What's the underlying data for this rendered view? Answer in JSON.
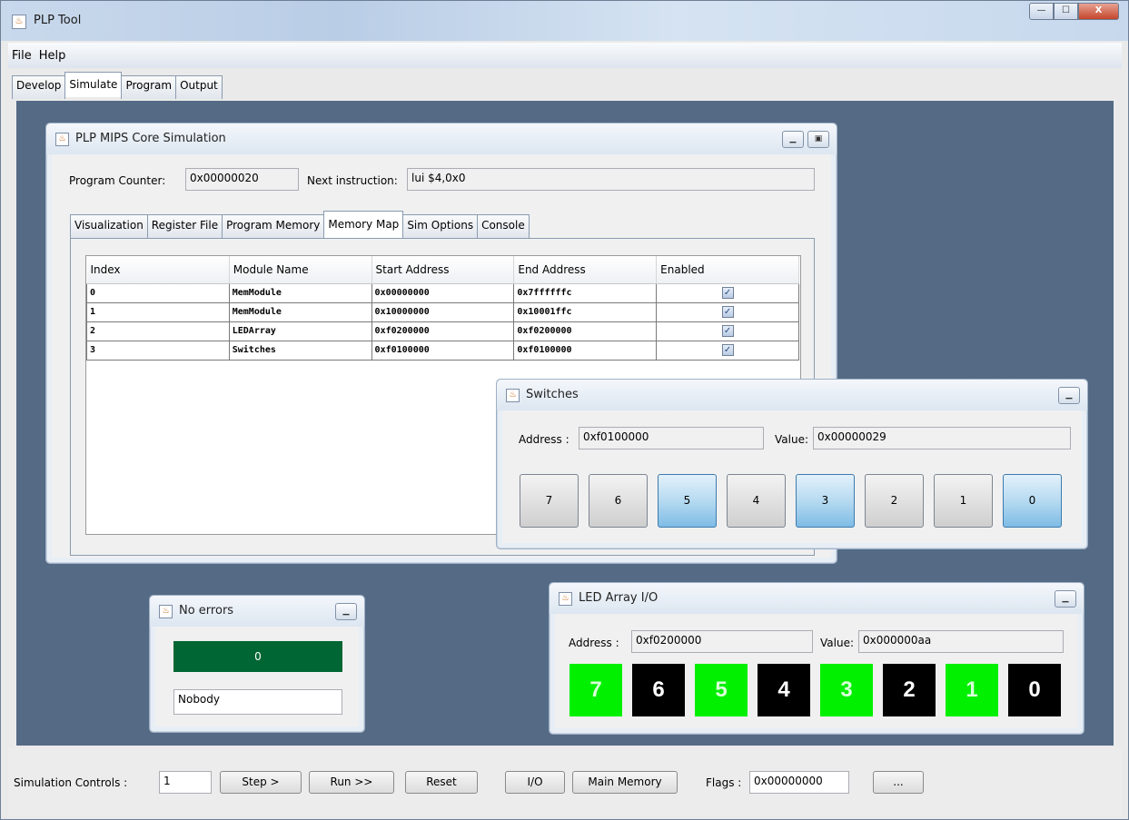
{
  "app": {
    "title": "PLP Tool"
  },
  "window_controls": {
    "minimize": "—",
    "maximize": "☐",
    "close": "X"
  },
  "menu": [
    "File",
    "Help"
  ],
  "main_tabs": [
    {
      "label": "Develop",
      "active": false
    },
    {
      "label": "Simulate",
      "active": true
    },
    {
      "label": "Program",
      "active": false
    },
    {
      "label": "Output",
      "active": false
    }
  ],
  "sim": {
    "title": "PLP MIPS Core Simulation",
    "pc_label": "Program Counter:",
    "pc_value": "0x00000020",
    "next_label": "Next instruction:",
    "next_value": "lui $4,0x0",
    "tabs": [
      {
        "label": "Visualization",
        "active": false
      },
      {
        "label": "Register File",
        "active": false
      },
      {
        "label": "Program Memory",
        "active": false
      },
      {
        "label": "Memory Map",
        "active": true
      },
      {
        "label": "Sim Options",
        "active": false
      },
      {
        "label": "Console",
        "active": false
      }
    ],
    "memory_map": {
      "columns": [
        "Index",
        "Module Name",
        "Start Address",
        "End Address",
        "Enabled"
      ],
      "rows": [
        {
          "index": "0",
          "module": "MemModule",
          "start": "0x00000000",
          "end": "0x7ffffffc",
          "enabled": true
        },
        {
          "index": "1",
          "module": "MemModule",
          "start": "0x10000000",
          "end": "0x10001ffc",
          "enabled": true
        },
        {
          "index": "2",
          "module": "LEDArray",
          "start": "0xf0200000",
          "end": "0xf0200000",
          "enabled": true
        },
        {
          "index": "3",
          "module": "Switches",
          "start": "0xf0100000",
          "end": "0xf0100000",
          "enabled": true
        }
      ]
    }
  },
  "switches": {
    "title": "Switches",
    "address_label": "Address :",
    "address": "0xf0100000",
    "value_label": "Value:",
    "value": "0x00000029",
    "buttons": [
      {
        "label": "7",
        "on": false
      },
      {
        "label": "6",
        "on": false
      },
      {
        "label": "5",
        "on": true
      },
      {
        "label": "4",
        "on": false
      },
      {
        "label": "3",
        "on": true
      },
      {
        "label": "2",
        "on": false
      },
      {
        "label": "1",
        "on": false
      },
      {
        "label": "0",
        "on": true
      }
    ]
  },
  "leds": {
    "title": "LED Array I/O",
    "address_label": "Address :",
    "address": "0xf0200000",
    "value_label": "Value:",
    "value": "0x000000aa",
    "items": [
      {
        "label": "7",
        "on": true
      },
      {
        "label": "6",
        "on": false
      },
      {
        "label": "5",
        "on": true
      },
      {
        "label": "4",
        "on": false
      },
      {
        "label": "3",
        "on": true
      },
      {
        "label": "2",
        "on": false
      },
      {
        "label": "1",
        "on": true
      },
      {
        "label": "0",
        "on": false
      }
    ],
    "on_color": "#00f000",
    "off_color": "#000000"
  },
  "errors": {
    "title": "No errors",
    "count": "0",
    "who": "Nobody",
    "bar_color": "#006633"
  },
  "controls": {
    "label": "Simulation Controls :",
    "steps": "1",
    "step": "Step >",
    "run": "Run >>",
    "reset": "Reset",
    "io": "I/O",
    "main_memory": "Main Memory",
    "flags_label": "Flags :",
    "flags": "0x00000000",
    "more": "..."
  },
  "colors": {
    "desktop": "#546a85"
  }
}
